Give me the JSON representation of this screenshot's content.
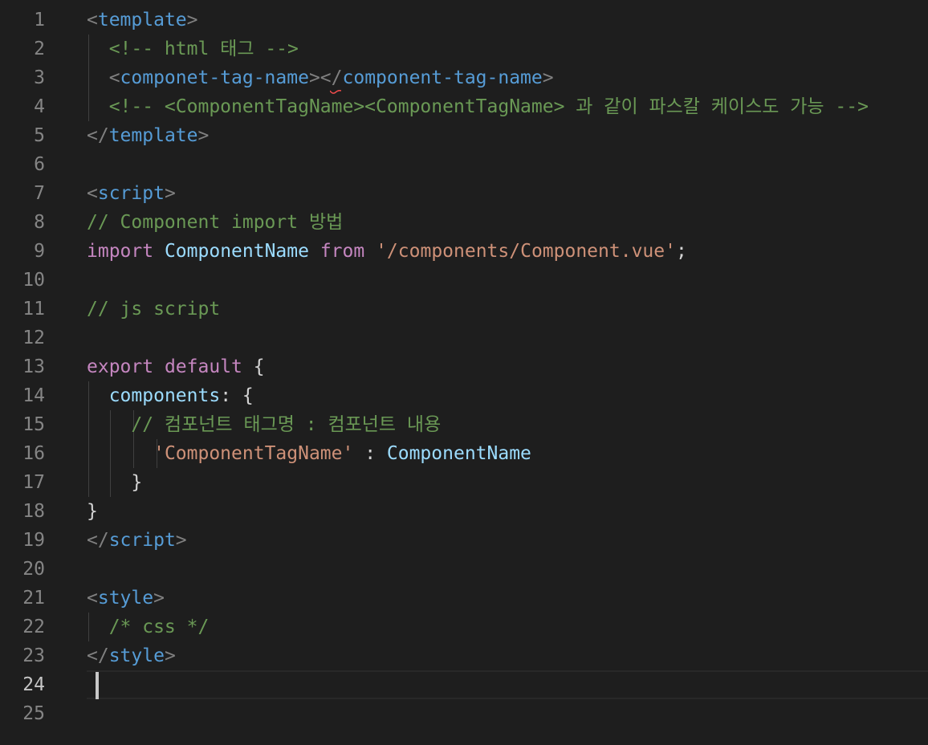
{
  "editor": {
    "active_line": 24,
    "lines": [
      {
        "num": "1",
        "tokens": [
          {
            "t": "<",
            "c": "punct"
          },
          {
            "t": "template",
            "c": "tag"
          },
          {
            "t": ">",
            "c": "punct"
          }
        ]
      },
      {
        "num": "2",
        "tokens": [
          {
            "t": "  <!-- html 태그 -->",
            "c": "comment"
          }
        ]
      },
      {
        "num": "3",
        "tokens": [
          {
            "t": "  <",
            "c": "punct"
          },
          {
            "t": "componet-tag-name",
            "c": "tag"
          },
          {
            "t": "></",
            "c": "punct"
          },
          {
            "t": "component-tag-name",
            "c": "tag"
          },
          {
            "t": ">",
            "c": "punct"
          }
        ]
      },
      {
        "num": "4",
        "tokens": [
          {
            "t": "  <!-- <ComponentTagName><ComponentTagName> 과 같이 파스칼 케이스도 가능 -->",
            "c": "comment"
          }
        ]
      },
      {
        "num": "5",
        "tokens": [
          {
            "t": "</",
            "c": "punct"
          },
          {
            "t": "template",
            "c": "tag"
          },
          {
            "t": ">",
            "c": "punct"
          }
        ]
      },
      {
        "num": "6",
        "tokens": []
      },
      {
        "num": "7",
        "tokens": [
          {
            "t": "<",
            "c": "punct"
          },
          {
            "t": "script",
            "c": "tag"
          },
          {
            "t": ">",
            "c": "punct"
          }
        ]
      },
      {
        "num": "8",
        "tokens": [
          {
            "t": "// Component import 방법",
            "c": "comment"
          }
        ]
      },
      {
        "num": "9",
        "tokens": [
          {
            "t": "import",
            "c": "kw"
          },
          {
            "t": " ",
            "c": "plain"
          },
          {
            "t": "ComponentName",
            "c": "var"
          },
          {
            "t": " ",
            "c": "plain"
          },
          {
            "t": "from",
            "c": "kw"
          },
          {
            "t": " ",
            "c": "plain"
          },
          {
            "t": "'/components/Component.vue'",
            "c": "str"
          },
          {
            "t": ";",
            "c": "plain"
          }
        ]
      },
      {
        "num": "10",
        "tokens": []
      },
      {
        "num": "11",
        "tokens": [
          {
            "t": "// js script",
            "c": "comment"
          }
        ]
      },
      {
        "num": "12",
        "tokens": []
      },
      {
        "num": "13",
        "tokens": [
          {
            "t": "export",
            "c": "kw"
          },
          {
            "t": " ",
            "c": "plain"
          },
          {
            "t": "default",
            "c": "kw"
          },
          {
            "t": " ",
            "c": "plain"
          },
          {
            "t": "{",
            "c": "plain"
          }
        ]
      },
      {
        "num": "14",
        "tokens": [
          {
            "t": "  ",
            "c": "plain"
          },
          {
            "t": "components",
            "c": "var"
          },
          {
            "t": ": ",
            "c": "plain"
          },
          {
            "t": "{",
            "c": "plain"
          }
        ]
      },
      {
        "num": "15",
        "tokens": [
          {
            "t": "    // 컴포넌트 태그명 : 컴포넌트 내용",
            "c": "comment"
          }
        ]
      },
      {
        "num": "16",
        "tokens": [
          {
            "t": "      ",
            "c": "plain"
          },
          {
            "t": "'ComponentTagName'",
            "c": "str"
          },
          {
            "t": " : ",
            "c": "plain"
          },
          {
            "t": "ComponentName",
            "c": "var"
          }
        ]
      },
      {
        "num": "17",
        "tokens": [
          {
            "t": "    }",
            "c": "plain"
          }
        ]
      },
      {
        "num": "18",
        "tokens": [
          {
            "t": "}",
            "c": "plain"
          }
        ]
      },
      {
        "num": "19",
        "tokens": [
          {
            "t": "</",
            "c": "punct"
          },
          {
            "t": "script",
            "c": "tag"
          },
          {
            "t": ">",
            "c": "punct"
          }
        ]
      },
      {
        "num": "20",
        "tokens": []
      },
      {
        "num": "21",
        "tokens": [
          {
            "t": "<",
            "c": "punct"
          },
          {
            "t": "style",
            "c": "tag"
          },
          {
            "t": ">",
            "c": "punct"
          }
        ]
      },
      {
        "num": "22",
        "tokens": [
          {
            "t": "  /* css */",
            "c": "comment"
          }
        ]
      },
      {
        "num": "23",
        "tokens": [
          {
            "t": "</",
            "c": "punct"
          },
          {
            "t": "style",
            "c": "tag"
          },
          {
            "t": ">",
            "c": "punct"
          }
        ]
      },
      {
        "num": "24",
        "tokens": []
      },
      {
        "num": "25",
        "tokens": []
      }
    ]
  }
}
